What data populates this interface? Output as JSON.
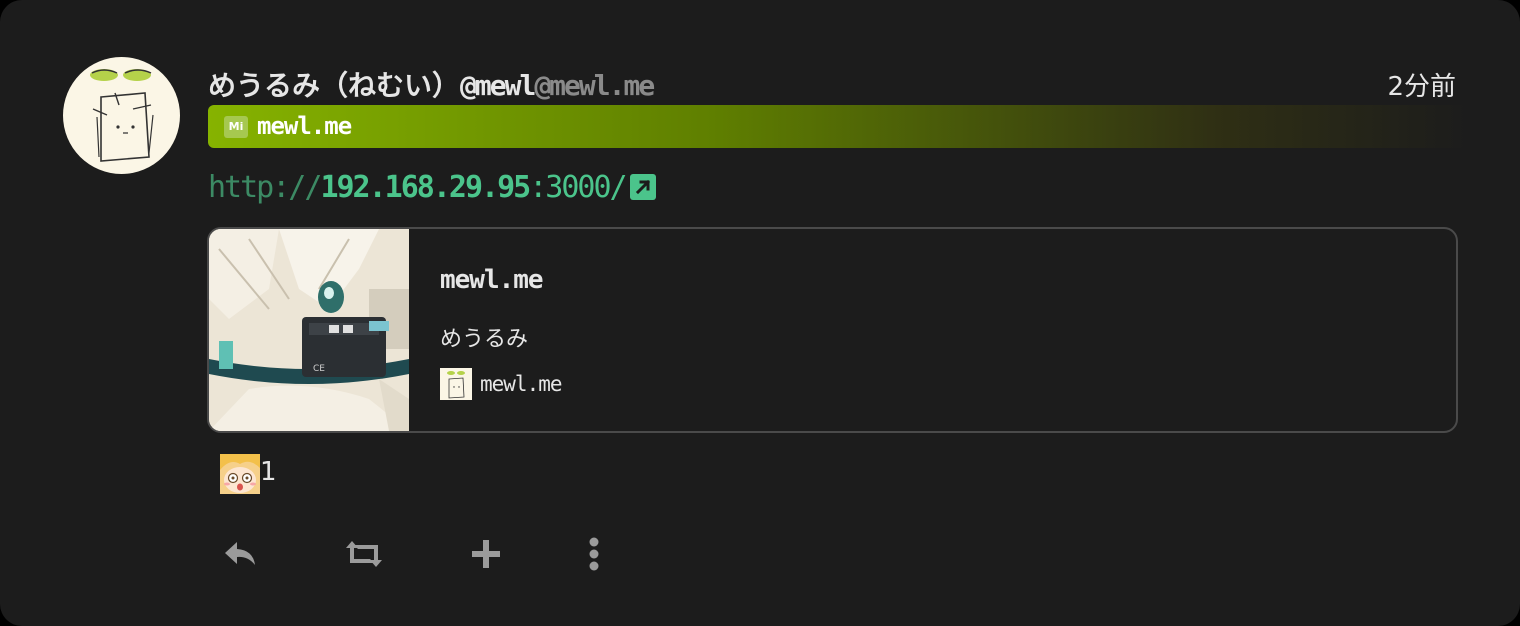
{
  "note": {
    "user": {
      "display_name": "めうるみ（ねむい）",
      "username": "@mewl",
      "host": "@mewl.me"
    },
    "timestamp": "2分前",
    "instance": {
      "icon_label": "Mi",
      "name": "mewl.me",
      "color": "#86b300"
    },
    "url": {
      "scheme": "http://",
      "host": "192.168.29.95",
      "rest": ":3000/"
    },
    "preview": {
      "title": "mewl.me",
      "description": "めうるみ",
      "site_name": "mewl.me"
    },
    "reaction": {
      "emoji": "surprised-girl-emoji",
      "count": "1"
    },
    "actions": [
      "reply-icon",
      "renote-icon",
      "add-reaction-icon",
      "more-icon"
    ]
  }
}
